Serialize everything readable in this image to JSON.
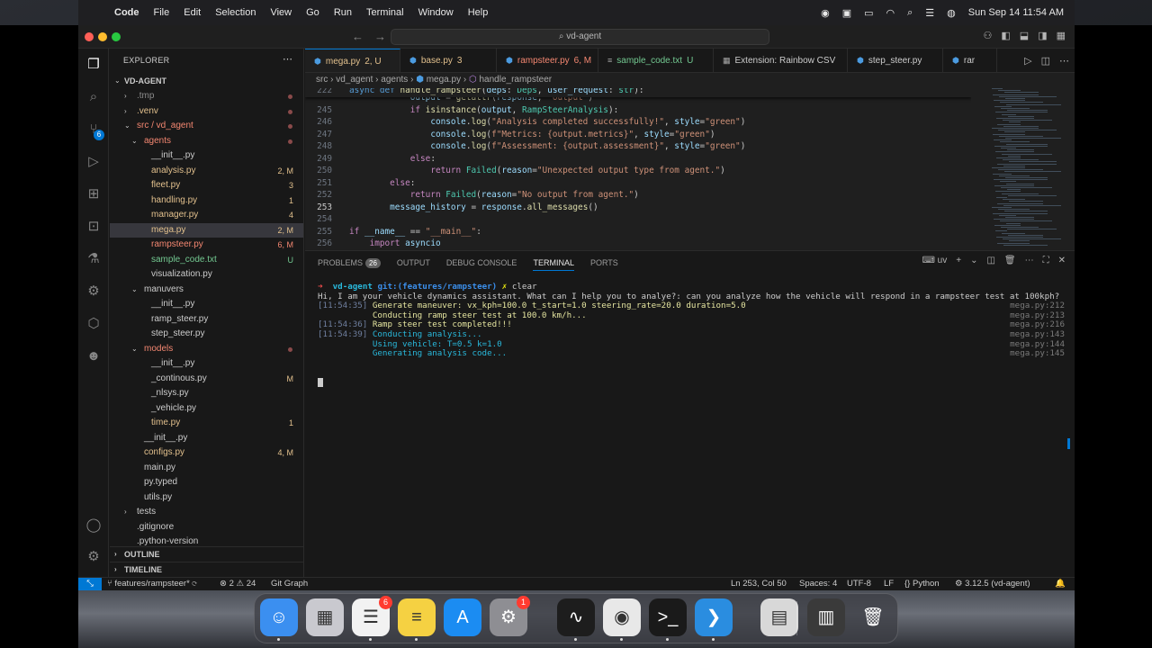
{
  "menubar": {
    "app": "Code",
    "items": [
      "File",
      "Edit",
      "Selection",
      "View",
      "Go",
      "Run",
      "Terminal",
      "Window",
      "Help"
    ],
    "clock": "Sun Sep 14  11:54 AM"
  },
  "window": {
    "search": "vd-agent"
  },
  "activity_badges": {
    "source_control": "6"
  },
  "explorer": {
    "title": "EXPLORER",
    "root": "VD-AGENT",
    "rows": [
      {
        "label": "tmp",
        "prefix": ".",
        "indent": 1,
        "chev": "›",
        "color": "dim",
        "status": "",
        "dot": true
      },
      {
        "label": ".venv",
        "indent": 1,
        "chev": "›",
        "color": "yel",
        "status": "",
        "dot": true
      },
      {
        "label": "src",
        "label2": "vd_agent",
        "indent": 1,
        "chev": "⌄",
        "color": "red",
        "status": "",
        "dot": true
      },
      {
        "label": "agents",
        "indent": 2,
        "chev": "⌄",
        "color": "red",
        "status": "",
        "dot": true
      },
      {
        "label": "__init__.py",
        "indent": 3,
        "color": "def",
        "status": ""
      },
      {
        "label": "analysis.py",
        "indent": 3,
        "color": "yel",
        "status": "2, M",
        "scolor": "yel"
      },
      {
        "label": "fleet.py",
        "indent": 3,
        "color": "yel",
        "status": "3",
        "scolor": "yel"
      },
      {
        "label": "handling.py",
        "indent": 3,
        "color": "yel",
        "status": "1",
        "scolor": "yel"
      },
      {
        "label": "manager.py",
        "indent": 3,
        "color": "yel",
        "status": "4",
        "scolor": "yel"
      },
      {
        "label": "mega.py",
        "indent": 3,
        "color": "yel",
        "status": "2, M",
        "scolor": "yel",
        "sel": true
      },
      {
        "label": "rampsteer.py",
        "indent": 3,
        "color": "red",
        "status": "6, M",
        "scolor": "red"
      },
      {
        "label": "sample_code.txt",
        "indent": 3,
        "color": "grn",
        "status": "U",
        "scolor": "grn"
      },
      {
        "label": "visualization.py",
        "indent": 3,
        "color": "def",
        "status": ""
      },
      {
        "label": "manuvers",
        "indent": 2,
        "chev": "⌄",
        "color": "def",
        "status": ""
      },
      {
        "label": "__init__.py",
        "indent": 3,
        "color": "def",
        "status": ""
      },
      {
        "label": "ramp_steer.py",
        "indent": 3,
        "color": "def",
        "status": ""
      },
      {
        "label": "step_steer.py",
        "indent": 3,
        "color": "def",
        "status": ""
      },
      {
        "label": "models",
        "indent": 2,
        "chev": "⌄",
        "color": "red",
        "status": "",
        "dot": true
      },
      {
        "label": "__init__.py",
        "indent": 3,
        "color": "def",
        "status": ""
      },
      {
        "label": "_continous.py",
        "indent": 3,
        "color": "def",
        "status": "M",
        "scolor": "yel"
      },
      {
        "label": "_nlsys.py",
        "indent": 3,
        "color": "def",
        "status": ""
      },
      {
        "label": "_vehicle.py",
        "indent": 3,
        "color": "def",
        "status": ""
      },
      {
        "label": "time.py",
        "indent": 3,
        "color": "yel",
        "status": "1",
        "scolor": "yel"
      },
      {
        "label": "__init__.py",
        "indent": 2,
        "color": "def",
        "status": ""
      },
      {
        "label": "configs.py",
        "indent": 2,
        "color": "yel",
        "status": "4, M",
        "scolor": "yel"
      },
      {
        "label": "main.py",
        "indent": 2,
        "color": "def",
        "status": ""
      },
      {
        "label": "py.typed",
        "indent": 2,
        "color": "def",
        "status": ""
      },
      {
        "label": "utils.py",
        "indent": 2,
        "color": "def",
        "status": ""
      },
      {
        "label": "tests",
        "indent": 1,
        "chev": "›",
        "color": "def",
        "status": ""
      },
      {
        "label": ".gitignore",
        "indent": 1,
        "color": "def",
        "status": ""
      },
      {
        "label": ".python-version",
        "indent": 1,
        "color": "def",
        "status": ""
      }
    ],
    "outline": "OUTLINE",
    "timeline": "TIMELINE"
  },
  "tabs": [
    {
      "label": "mega.py",
      "status": "2, U",
      "color": "yel",
      "active": true,
      "icon": "python-icon"
    },
    {
      "label": "base.py",
      "status": "3",
      "color": "yel",
      "icon": "python-icon"
    },
    {
      "label": "rampsteer.py",
      "status": "6, M",
      "color": "red",
      "icon": "python-icon"
    },
    {
      "label": "sample_code.txt",
      "status": "U",
      "color": "grn",
      "icon": "text-file-icon"
    },
    {
      "label": "Extension: Rainbow CSV",
      "status": "",
      "color": "def",
      "icon": "extension-icon"
    },
    {
      "label": "step_steer.py",
      "status": "",
      "color": "def",
      "icon": "python-icon"
    },
    {
      "label": "rar",
      "status": "",
      "color": "def",
      "icon": "python-icon"
    }
  ],
  "breadcrumb": [
    "src",
    "vd_agent",
    "agents",
    "mega.py",
    "handle_rampsteer"
  ],
  "code": {
    "sticky": {
      "ln": "222",
      "text": "async def handle_rampsteer(deps: Deps, user_request: str):"
    },
    "lines": [
      {
        "ln": "",
        "text": "            output = getattr(response, \"output\")"
      },
      {
        "ln": "245",
        "text": "            if isinstance(output, RampSteerAnalysis):"
      },
      {
        "ln": "246",
        "text": "                console.log(\"Analysis completed successfully!\", style=\"green\")"
      },
      {
        "ln": "247",
        "text": "                console.log(f\"Metrics: {output.metrics}\", style=\"green\")"
      },
      {
        "ln": "248",
        "text": "                console.log(f\"Assessment: {output.assessment}\", style=\"green\")"
      },
      {
        "ln": "249",
        "text": "            else:"
      },
      {
        "ln": "250",
        "text": "                return Failed(reason=\"Unexpected output type from agent.\")"
      },
      {
        "ln": "251",
        "text": "        else:"
      },
      {
        "ln": "252",
        "text": "            return Failed(reason=\"No output from agent.\")"
      },
      {
        "ln": "253",
        "text": "        message_history = response.all_messages()"
      },
      {
        "ln": "254",
        "text": ""
      },
      {
        "ln": "255",
        "text": "if __name__ == \"__main__\":"
      },
      {
        "ln": "256",
        "text": "    import asyncio"
      }
    ],
    "current_line": "253"
  },
  "panel": {
    "tabs": [
      "PROBLEMS",
      "OUTPUT",
      "DEBUG CONSOLE",
      "TERMINAL",
      "PORTS"
    ],
    "problems_count": "26",
    "active": "TERMINAL",
    "shell": "uv"
  },
  "terminal": {
    "prompt_user": "vd-agent",
    "prompt_git": "git:(features/rampsteer)",
    "prompt_mark": "✗",
    "prompt_cmd": "clear",
    "lines": [
      {
        "ts": "",
        "text": "Hi, I am your vehicle dynamics assistant. What can I help you to analye?: can you analyze how the vehicle will respond in a rampsteer test at 100kph?",
        "ref": "",
        "color": "#cccccc"
      },
      {
        "ts": "[11:54:35]",
        "text": "Generate maneuver: vx_kph=100.0 t_start=1.0 steering_rate=20.0 duration=5.0",
        "ref": "mega.py:212",
        "color": "#e5e5a0"
      },
      {
        "ts": "",
        "text": "Conducting ramp steer test at 100.0 km/h...",
        "ref": "mega.py:213",
        "color": "#e5e5a0"
      },
      {
        "ts": "[11:54:36]",
        "text": "Ramp steer test completed!!!",
        "ref": "mega.py:216",
        "color": "#e5e5a0"
      },
      {
        "ts": "[11:54:39]",
        "text": "Conducting analysis...",
        "ref": "mega.py:143",
        "color": "#29b8db"
      },
      {
        "ts": "",
        "text": "Using vehicle: T=0.5 k=1.0",
        "ref": "mega.py:144",
        "color": "#29b8db"
      },
      {
        "ts": "",
        "text": "Generating analysis code...",
        "ref": "mega.py:145",
        "color": "#29b8db"
      }
    ]
  },
  "status": {
    "branch": "features/rampsteer*",
    "errors": "2",
    "warnings": "24",
    "git_graph": "Git Graph",
    "position": "Ln 253, Col 50",
    "spaces": "Spaces: 4",
    "encoding": "UTF-8",
    "eol": "LF",
    "language": "Python",
    "interpreter": "3.12.5 (vd-agent)"
  },
  "dock": {
    "apps": [
      {
        "name": "finder",
        "glyph": "☺",
        "bg": "#3b8ff0"
      },
      {
        "name": "launchpad",
        "glyph": "▦",
        "bg": "#c9c9cf"
      },
      {
        "name": "reminders",
        "glyph": "☰",
        "bg": "#f2f2f2",
        "badge": "6"
      },
      {
        "name": "notes",
        "glyph": "≡",
        "bg": "#f5d142"
      },
      {
        "name": "app-store",
        "glyph": "A",
        "bg": "#1b8cf2"
      },
      {
        "name": "system-settings",
        "glyph": "⚙",
        "bg": "#8e8e93",
        "badge": "1"
      },
      {
        "name": "activity-monitor",
        "glyph": "∿",
        "bg": "#1d1d1d"
      },
      {
        "name": "chrome",
        "glyph": "◉",
        "bg": "#e8e8e8"
      },
      {
        "name": "terminal",
        "glyph": ">_",
        "bg": "#1a1a1a"
      },
      {
        "name": "vscode",
        "glyph": "❯",
        "bg": "#2a8de0"
      },
      {
        "name": "preview",
        "glyph": "▤",
        "bg": "#d8d8d8"
      },
      {
        "name": "stack",
        "glyph": "▥",
        "bg": "#3a3a3a"
      },
      {
        "name": "trash",
        "glyph": "🗑",
        "bg": "transparent"
      }
    ]
  }
}
